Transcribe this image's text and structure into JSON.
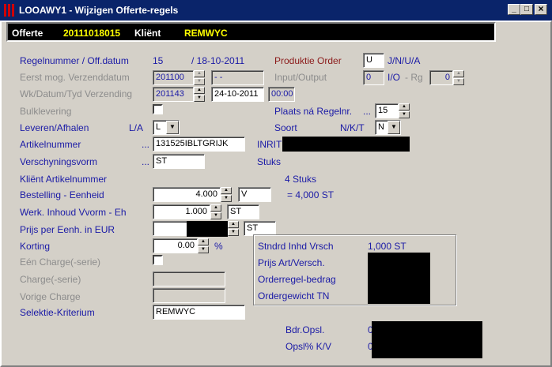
{
  "window": {
    "title": "LOOAWY1 - Wijzigen Offerte-regels",
    "minimize": "_",
    "maximize": "□",
    "close": "×"
  },
  "header": {
    "offerte_label": "Offerte",
    "offerte_value": "20111018015",
    "klient_label": "Kliënt",
    "klient_value": "REMWYC"
  },
  "form": {
    "regelnummer_label": "Regelnummer / Off.datum",
    "regelnummer_value": "15",
    "offdatum_value": "/ 18-10-2011",
    "produktie_label": "Produktie Order",
    "produktie_value": "U",
    "produktie_options": "J/N/U/A",
    "eerst_label": "Eerst mog. Verzenddatum",
    "eerst_week": "201100",
    "eerst_date": "- -",
    "inout_label": "Input/Output",
    "inout_value": "0",
    "io_label": "I/O",
    "rg_label": "- Rg",
    "rg_value": "0",
    "wk_label": "Wk/Datum/Tyd Verzending",
    "wk_week": "201143",
    "wk_date": "24-10-2011",
    "wk_time": "00:00",
    "bulk_label": "Bulklevering",
    "plaats_label": "Plaats ná Regelnr.",
    "plaats_dots": "...",
    "plaats_value": "15",
    "leveren_label": "Leveren/Afhalen",
    "leveren_hint": "L/A",
    "leveren_value": "L",
    "soort_label": "Soort",
    "soort_hint": "N/K/T",
    "soort_value": "N",
    "artikel_label": "Artikelnummer",
    "artikel_dots": "...",
    "artikel_value": "131525IBLTGRIJK",
    "artikel_desc": "INRIT",
    "versch_label": "Verschyningsvorm",
    "versch_dots": "...",
    "versch_value": "ST",
    "versch_desc": "Stuks",
    "klient_art_label": "Kliënt Artikelnummer",
    "stuks_text": "4 Stuks",
    "bestelling_label": "Bestelling - Eenheid",
    "bestelling_value": "4.000",
    "bestelling_unit": "V",
    "bestelling_result": "= 4,000 ST",
    "werk_label": "Werk. Inhoud Vvorm - Eh",
    "werk_value": "1.000",
    "werk_unit": "ST",
    "prijs_label": "Prijs per Eenh. in EUR",
    "prijs_unit": "ST",
    "korting_label": "Korting",
    "korting_value": "0.00",
    "korting_unit": "%",
    "een_charge_label": "Eén Charge(-serie)",
    "charge_label": "Charge(-serie)",
    "vorige_label": "Vorige Charge",
    "selektie_label": "Selektie-Kriterium",
    "selektie_value": "REMWYC"
  },
  "summary": {
    "stndrd_label": "Stndrd Inhd Vrsch",
    "stndrd_value": "1,000 ST",
    "prijs_art_label": "Prijs Art/Versch.",
    "orderregel_label": "Orderregel-bedrag",
    "ordergewicht_label": "Ordergewicht TN",
    "bdr_label": "Bdr.Opsl.",
    "bdr_value": "0",
    "opsl_label": "Opsl% K/V",
    "opsl_value": "0"
  },
  "colors": {
    "title_bar": "#0a246a",
    "label_blue": "#1a1aa6",
    "header_yellow": "#ffff00",
    "produktie_red": "#8b1a1a"
  }
}
